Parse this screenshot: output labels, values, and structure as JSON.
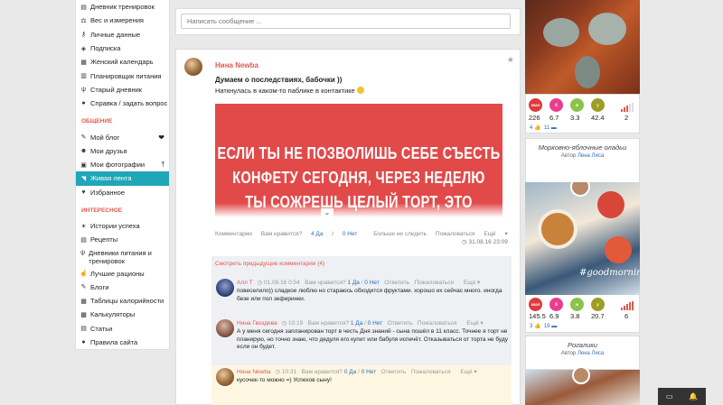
{
  "sidebar": {
    "top_items": [
      {
        "label": "Дневник тренировок",
        "icon": "notebook-icon"
      },
      {
        "label": "Вес и измерения",
        "icon": "scales-icon"
      },
      {
        "label": "Личные данные",
        "icon": "key-icon"
      },
      {
        "label": "Подписка",
        "icon": "tag-icon"
      },
      {
        "label": "Женский календарь",
        "icon": "calendar-icon"
      },
      {
        "label": "Планировщик питания",
        "icon": "planner-icon"
      },
      {
        "label": "Старый дневник",
        "icon": "fork-knife-icon"
      },
      {
        "label": "Справка / задать вопрос",
        "icon": "help-icon"
      }
    ],
    "section_social": "ОБЩЕНИЕ",
    "social_items": [
      {
        "label": "Мой блог",
        "icon": "pencil-icon"
      },
      {
        "label": "Мои друзья",
        "icon": "users-icon"
      },
      {
        "label": "Мои фотографии",
        "icon": "camera-icon"
      },
      {
        "label": "Живая лента",
        "icon": "rss-icon"
      },
      {
        "label": "Избранное",
        "icon": "heart-icon"
      }
    ],
    "section_interesting": "ИНТЕРЕСНОЕ",
    "interesting_items": [
      {
        "label": "Истории успеха",
        "icon": "sparkle-icon"
      },
      {
        "label": "Рецепты",
        "icon": "recipe-icon"
      },
      {
        "label": "Дневники питания и тренировок",
        "icon": "fork-knife-icon"
      },
      {
        "label": "Лучшие рационы",
        "icon": "thumbs-up-icon"
      },
      {
        "label": "Блоги",
        "icon": "pencil-icon"
      },
      {
        "label": "Таблицы калорийности",
        "icon": "table-icon"
      },
      {
        "label": "Калькуляторы",
        "icon": "calculator-icon"
      },
      {
        "label": "Статьи",
        "icon": "article-icon"
      },
      {
        "label": "Правила сайта",
        "icon": "info-icon"
      }
    ]
  },
  "message_input": {
    "placeholder": "Написать сообщение ..."
  },
  "post": {
    "author": "Нина Newba",
    "title": "Думаем о последствиях, бабочки ))",
    "text": "Наткнулась в каком-то паблике в контактике",
    "image_lines": [
      "ЕСЛИ ТЫ НЕ ПОЗВОЛИШЬ СЕБЕ СЪЕСТЬ",
      "КОНФЕТУ СЕГОДНЯ, ЧЕРЕЗ НЕДЕЛЮ",
      "ТЫ СОЖРЕШЬ ЦЕЛЫЙ ТОРТ, ЭТО"
    ],
    "actions": {
      "comments": "Комментарии",
      "like_q": "Вам нравится?",
      "yes": "4 Да",
      "sep": "/",
      "no": "0 Нет",
      "unfollow": "Больше не следить",
      "complain": "Пожаловаться",
      "more": "Ещё"
    },
    "date": "31.08.16 23:09"
  },
  "comments": {
    "show_previous": "Смотреть предыдущие комментарии (4)",
    "items": [
      {
        "name": "Алл Т",
        "time": "01.09.16 0:54",
        "like_q": "Вам нравится?",
        "yes": "1 Да",
        "no": "0 Нет",
        "reply": "Ответить",
        "complain": "Пожаловаться",
        "more": "Ещё",
        "text": "повеселило)) сладкое люблю но стараюсь обходится фруктами. хорошо их сейчас много. иногда безе или пол зефиринки."
      },
      {
        "name": "Нина Гвоздева",
        "time": "10:19",
        "like_q": "Вам нравится?",
        "yes": "1 Да",
        "no": "0 Нет",
        "reply": "Ответить",
        "complain": "Пожаловаться",
        "more": "Ещё",
        "text": "А у меня сегодня запланирован торт в честь Дня знаний - сына пошёл в 11 класс. Точнее я торт не планирую, но точно знаю, что дедуля его купит или бабуля испечёт. Отказываться от торта не буду если он будет."
      },
      {
        "name": "Нина Newba",
        "time": "10:31",
        "like_q": "Вам нравится?",
        "yes": "0 Да",
        "no": "0 Нет",
        "reply": "Ответить",
        "complain": "Пожаловаться",
        "more": "Ещё",
        "text": "кусочек-то можно =) Успехов сыну!"
      }
    ]
  },
  "recipes": [
    {
      "badges": [
        "ккал",
        "б",
        "ж",
        "у"
      ],
      "values": [
        "226",
        "6.7",
        "3.3",
        "42.4"
      ],
      "rating": "2",
      "likes": "4",
      "comments": "11"
    },
    {
      "title": "Морковно-яблочные оладьи",
      "author_label": "Автор",
      "author": "Лена Лиса",
      "photo_caption": "#goodmornin",
      "badges": [
        "ккал",
        "б",
        "ж",
        "у"
      ],
      "values": [
        "145.5",
        "6.9",
        "3.8",
        "20.7"
      ],
      "rating": "6",
      "likes": "3",
      "comments": "19"
    },
    {
      "title": "Рогалики",
      "author_label": "Автор",
      "author": "Лена Лиса"
    }
  ],
  "badge_colors": [
    "#e0393e",
    "#e83e8c",
    "#8bc34a",
    "#9e9d24"
  ],
  "accent_color": "#1fa6b7",
  "link_color": "#2d6db8",
  "name_color": "#e05a4e"
}
